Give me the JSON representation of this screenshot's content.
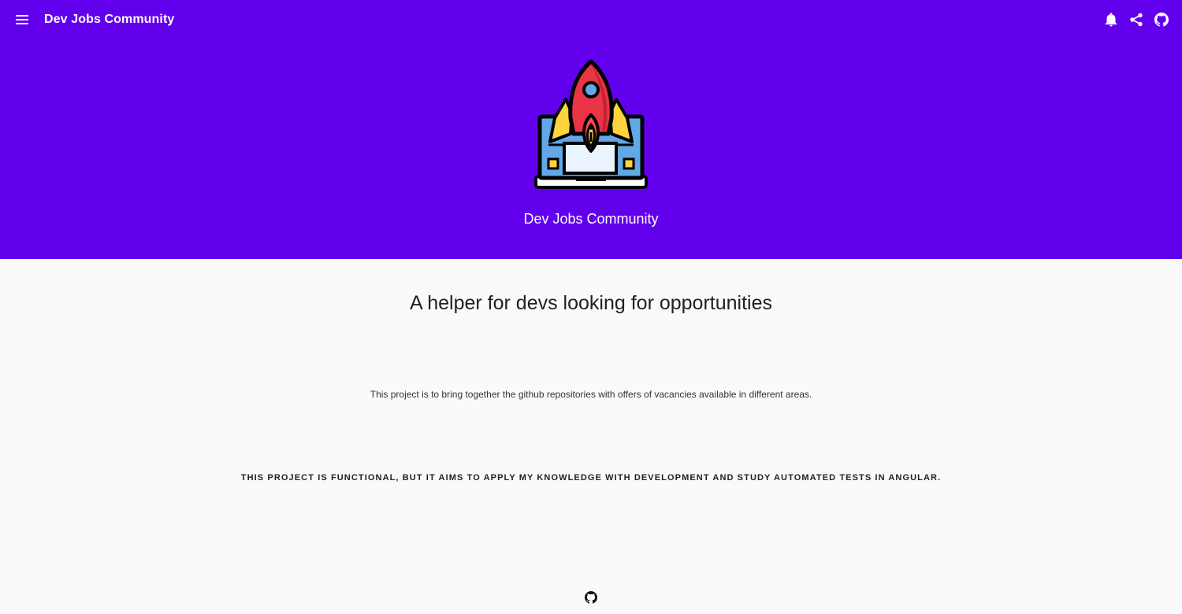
{
  "toolbar": {
    "menu_icon": "menu-icon",
    "title": "Dev Jobs Community",
    "actions": [
      {
        "icon": "bell-icon"
      },
      {
        "icon": "share-icon"
      },
      {
        "icon": "github-icon"
      }
    ]
  },
  "hero": {
    "logo_icon": "rocket-laptop-logo",
    "title": "Dev Jobs Community"
  },
  "main": {
    "headline": "A helper for devs looking for opportunities",
    "description": "This project is to bring together the github repositories with offers of vacancies available in different areas.",
    "notice": "This project is functional, but it aims to apply my knowledge with development and study automated tests in Angular."
  },
  "footer": {
    "link_icon": "github-icon"
  },
  "colors": {
    "primary": "#6200ee",
    "background": "#fafafa",
    "on_primary": "#ffffff",
    "text": "#212121"
  }
}
